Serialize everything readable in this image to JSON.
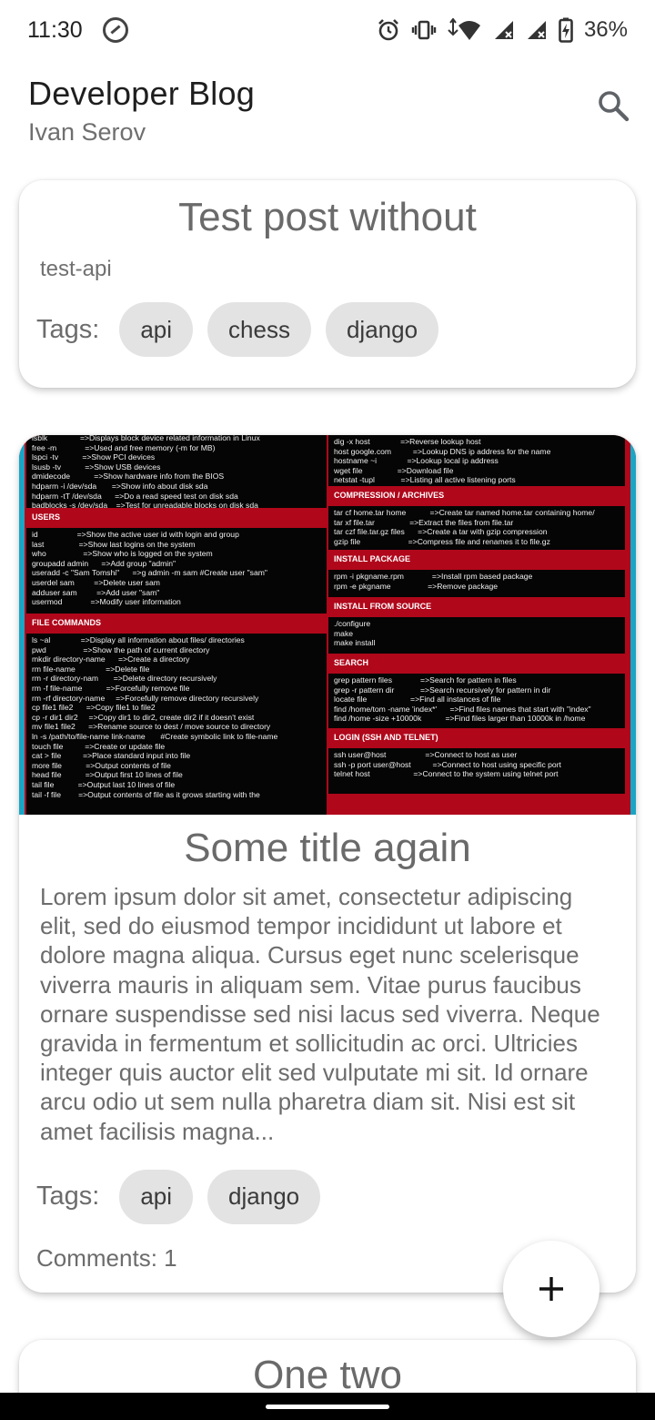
{
  "status_bar": {
    "time": "11:30",
    "battery": "36%",
    "icons": [
      "app-notification-icon",
      "alarm-icon",
      "vibrate-icon",
      "wifi-icon",
      "signal-icon",
      "signal-icon",
      "battery-charging-icon"
    ]
  },
  "header": {
    "title": "Developer Blog",
    "subtitle": "Ivan Serov",
    "search_icon": "search-icon"
  },
  "posts": [
    {
      "title": "Test post without",
      "slug": "test-api",
      "tags_label": "Tags:",
      "tags": [
        "api",
        "chess",
        "django"
      ]
    },
    {
      "title": "Some title again",
      "body": "Lorem ipsum dolor sit amet, consectetur adipiscing elit, sed do eiusmod tempor incididunt ut labore et dolore magna aliqua. Cursus eget nunc scelerisque viverra mauris in aliquam sem. Vitae purus faucibus ornare suspendisse sed nisi lacus sed viverra. Neque gravida in fermentum et sollicitudin ac orci. Ultricies integer quis auctor elit sed vulputate mi sit. Id ornare arcu odio ut sem nulla pharetra diam sit. Nisi est sit amet facilisis magna...",
      "tags_label": "Tags:",
      "tags": [
        "api",
        "django"
      ],
      "comments": "Comments: 1",
      "image": {
        "left_top_lines": "lsblk               =>Displays block device related information in Linux\nfree -m             =>Used and free memory (-m for MB)\nlspci -tv           =>Show PCI devices\nlsusb -tv           =>Show USB devices\ndmidecode           =>Show hardware info from the BIOS\nhdparm -i /dev/sda       =>Show info about disk sda\nhdparm -tT /dev/sda      =>Do a read speed test on disk sda\nbadblocks -s /dev/sda    =>Test for unreadable blocks on disk sda",
        "users_head": "USERS",
        "users_lines": "id                  =>Show the active user id with login and group\nlast                =>Show last logins on the system\nwho                 =>Show who is logged on the system\ngroupadd admin      =>Add group \"admin\"\nuseradd -c \"Sam Tomshi\"      =>g admin -m sam #Create user \"sam\"\nuserdel sam         =>Delete user sam\nadduser sam         =>Add user \"sam\"\nusermod             =>Modify user information",
        "files_head": "FILE COMMANDS",
        "files_lines": "ls ~al              =>Display all information about files/ directories\npwd                 =>Show the path of current directory\nmkdir directory-name      =>Create a directory\nrm file-name              =>Delete file\nrm -r directory-nam       =>Delete directory recursively\nrm -f file-name           =>Forcefully remove file\nrm -rf directory-name     =>Forcefully remove directory recursively\ncp file1 file2      =>Copy file1 to file2\ncp -r dir1 dir2     =>Copy dir1 to dir2, create dir2 if it doesn't exist\nmv file1 file2      =>Rename source to dest / move source to directory\nln -s /path/to/file-name link-name       #Create symbolic link to file-name\ntouch file          =>Create or update file\ncat > file          =>Place standard input into file\nmore file           =>Output contents of file\nhead file           =>Output first 10 lines of file\ntail file           =>Output last 10 lines of file\ntail -f file        =>Output contents of file as it grows starting with the",
        "right_top_lines": "dig -x host              =>Reverse lookup host\nhost google.com          =>Lookup DNS ip address for the name\nhostname ~i              =>Lookup local ip address\nwget file                =>Download file\nnetstat -tupl            =>Listing all active listening ports",
        "compression_head": "COMPRESSION / ARCHIVES",
        "compression_lines": "tar cf home.tar home           =>Create tar named home.tar containing home/\ntar xf file.tar                =>Extract the files from file.tar\ntar czf file.tar.gz files      =>Create a tar with gzip compression\ngzip file                      =>Compress file and renames it to file.gz",
        "install_head": "INSTALL PACKAGE",
        "install_lines": "rpm -i pkgname.rpm             =>Install rpm based package\nrpm -e pkgname                 =>Remove package",
        "source_head": "INSTALL FROM SOURCE",
        "source_lines": "./configure\nmake\nmake install",
        "search_head": "SEARCH",
        "search_lines": "grep pattern files             =>Search for pattern in files\ngrep -r pattern dir            =>Search recursively for pattern in dir\nlocate file                    =>Find all instances of file\nfind /home/tom -name 'index*'      =>Find files names that start with \"index\"\nfind /home -size +10000k           =>Find files larger than 10000k in /home",
        "login_head": "LOGIN (SSH AND TELNET)",
        "login_lines": "ssh user@host                  =>Connect to host as user\nssh -p port user@host          =>Connect to host using specific port\ntelnet host                    =>Connect to the system using telnet port"
      }
    },
    {
      "title": "One two"
    }
  ],
  "fab": {
    "icon": "plus-icon"
  },
  "colors": {
    "chip_bg": "#e3e3e3",
    "cheatsheet_red": "#b0071b",
    "cheatsheet_border": "#1aa5c4"
  }
}
